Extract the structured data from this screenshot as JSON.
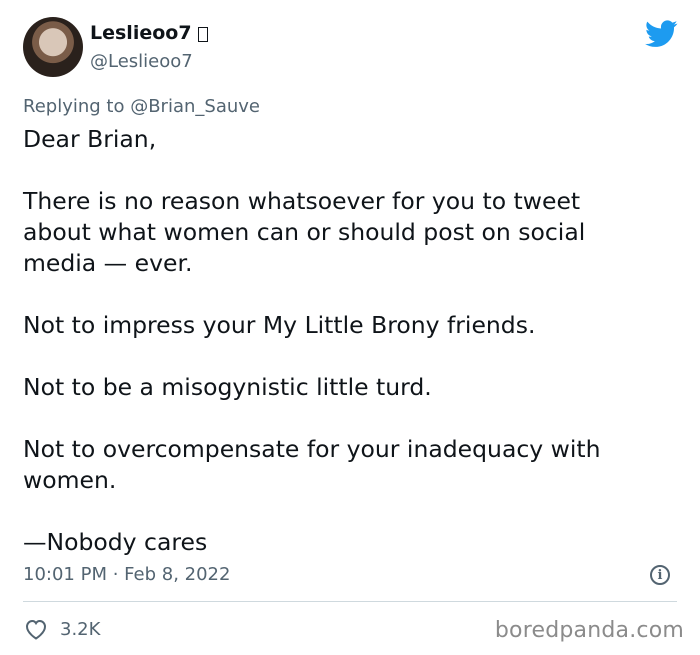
{
  "tweet": {
    "display_name": "Leslieoo7",
    "handle": "@Leslieoo7",
    "replying_prefix": "Replying to ",
    "replying_to": "@Brian_Sauve",
    "body": {
      "greeting": "Dear Brian,",
      "p1_l1": "There is no reason whatsoever for you to tweet",
      "p1_l2": "about what women can or should post on social",
      "p1_l3": "media — ever.",
      "p2": "Not to impress your My Little Brony friends.",
      "p3": "Not to be a misogynistic little turd.",
      "p4_l1": "Not to overcompensate for your inadequacy with",
      "p4_l2": "women.",
      "signoff": "—Nobody cares"
    },
    "time": "10:01 PM",
    "separator": " · ",
    "date": "Feb 8, 2022",
    "likes": "3.2K"
  },
  "icons": {
    "brand": "twitter-bird-icon",
    "info": "info-icon",
    "like": "heart-icon"
  },
  "colors": {
    "twitter_blue": "#1d9bf0",
    "secondary_text": "#536471",
    "primary_text": "#0f1419"
  },
  "watermark": "boredpanda.com"
}
